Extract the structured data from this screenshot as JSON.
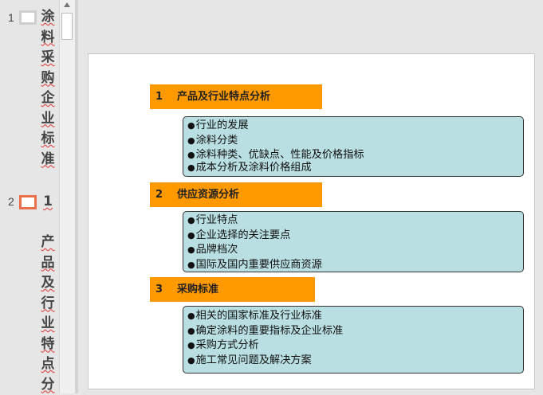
{
  "thumbnails": [
    {
      "number": "1",
      "chars": [
        "涂",
        "料",
        "采",
        "购",
        "企",
        "业",
        "标",
        "准"
      ]
    },
    {
      "number": "2",
      "chars": [
        "1",
        "",
        "产",
        "品",
        "及",
        "行",
        "业",
        "特",
        "点",
        "分"
      ]
    }
  ],
  "sections": [
    {
      "number": "1",
      "title": "产品及行业特点分析",
      "items": [
        "行业的发展",
        "涂料分类",
        "涂料种类、优缺点、性能及价格指标",
        "成本分析及涂料价格组成"
      ]
    },
    {
      "number": "2",
      "title": "供应资源分析",
      "items": [
        "行业特点",
        "企业选择的关注要点",
        "品牌档次",
        "国际及国内重要供应商资源"
      ]
    },
    {
      "number": "3",
      "title": "采购标准",
      "items": [
        "相关的国家标准及行业标准",
        "确定涂料的重要指标及企业标准",
        "采购方式分析",
        "施工常见问题及解决方案"
      ]
    }
  ],
  "bullet_glyph": "●",
  "colors": {
    "header": "#ff9900",
    "box": "#b9dfe2",
    "active_thumb": "#e8704c"
  }
}
